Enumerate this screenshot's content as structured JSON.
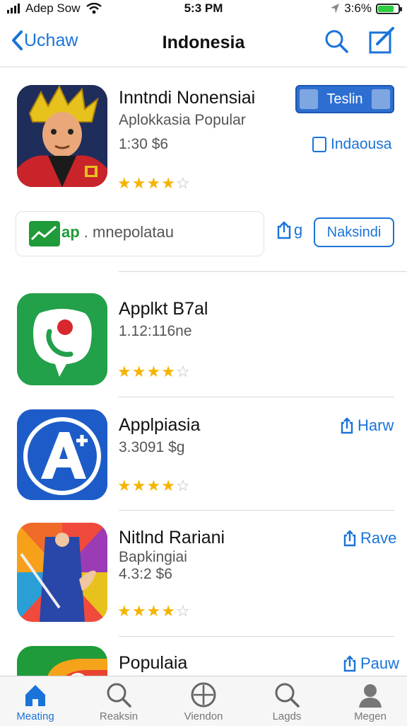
{
  "status_bar": {
    "carrier": "Adep Sow",
    "time": "5:3 PM",
    "battery_text": "3:6%",
    "battery_level": 0.86,
    "battery_color": "#2ecc40"
  },
  "nav": {
    "back_label": "Uchaw",
    "title": "Indonesia",
    "search_icon": "search-icon",
    "compose_icon": "compose-icon"
  },
  "featured": {
    "name": "Inntndi Nonensiai",
    "subtitle": "Aplokkasia Popular",
    "meta": "1:30 $6",
    "rating": 4,
    "action_label": "Teslin",
    "country_label": "Indaousa"
  },
  "promo": {
    "prefix": "ap",
    "text": " . mnepolatau",
    "share_label": "g",
    "install_label": "Naksindi"
  },
  "apps": [
    {
      "name": "Applkt B7al",
      "meta": "1.12:116ne",
      "rating": 4,
      "action": ""
    },
    {
      "name": "Applpiasia",
      "meta": "3.3091 $g",
      "rating": 4,
      "action": "Harw"
    },
    {
      "name": "Nitlnd Rariani",
      "sub": "Bapkingiai",
      "meta": "4.3:2 $6",
      "rating": 4,
      "action": "Rave"
    },
    {
      "name": "Populaia",
      "meta": "",
      "rating": 0,
      "action": "Pauw"
    }
  ],
  "tabs": [
    {
      "label": "Meating",
      "icon": "home-icon",
      "active": true
    },
    {
      "label": "Reaksin",
      "icon": "search-icon",
      "active": false
    },
    {
      "label": "Viendon",
      "icon": "plus-circle-icon",
      "active": false
    },
    {
      "label": "Lagds",
      "icon": "search-icon",
      "active": false
    },
    {
      "label": "Megen",
      "icon": "person-icon",
      "active": false
    }
  ],
  "colors": {
    "accent": "#1a73d9",
    "star": "#f5b400",
    "green": "#1f9b3a"
  }
}
